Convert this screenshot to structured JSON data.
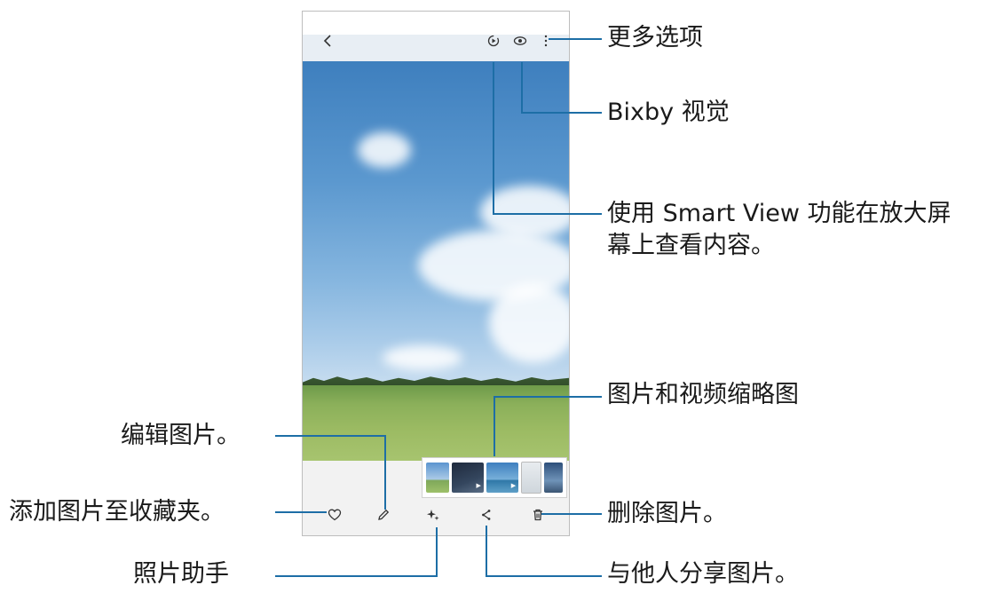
{
  "callouts": {
    "more_options": "更多选项",
    "bixby_vision": "Bixby 视觉",
    "smart_view_line1": "使用 Smart View 功能在放大屏",
    "smart_view_line2": "幕上查看内容。",
    "thumbnails": "图片和视频缩略图",
    "edit": "编辑图片。",
    "favorite": "添加图片至收藏夹。",
    "delete": "删除图片。",
    "assistant": "照片助手",
    "share": "与他人分享图片。"
  },
  "icons": {
    "back": "back-arrow-icon",
    "smart_view": "smart-view-icon",
    "bixby": "eye-icon",
    "more": "more-options-icon",
    "favorite": "heart-icon",
    "edit": "pencil-icon",
    "assistant": "sparkle-icon",
    "share": "share-icon",
    "delete": "trash-icon"
  },
  "colors": {
    "leader_line": "#1d6ea6"
  }
}
